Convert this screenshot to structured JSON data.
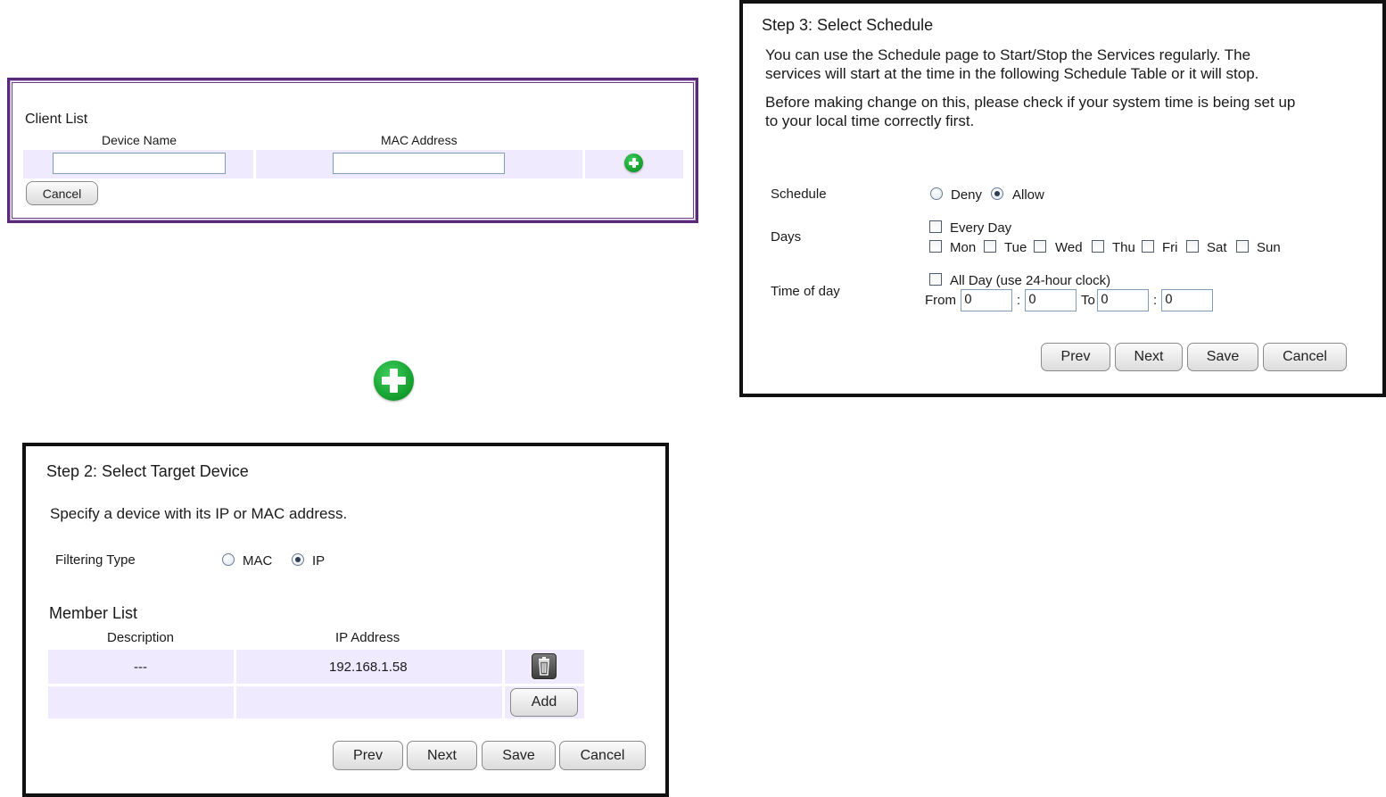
{
  "client_list": {
    "title": "Client List",
    "col_device_name": "Device Name",
    "col_mac_address": "MAC Address",
    "device_name_value": "",
    "mac_address_value": "",
    "add_icon": "plus-circle-icon",
    "cancel_label": "Cancel"
  },
  "floating_icon": "plus-circle-icon",
  "step3": {
    "title": "Step 3: Select Schedule",
    "para1_line1": "You can use the Schedule page to Start/Stop the Services regularly. The",
    "para1_line2": "services will start at the time in the following Schedule Table or it will stop.",
    "para2_line1": "Before making change on this, please check if your system time is being set up",
    "para2_line2": "to your local time correctly first.",
    "schedule_label": "Schedule",
    "deny_label": "Deny",
    "allow_label": "Allow",
    "schedule_selected": "Allow",
    "days_label": "Days",
    "every_day_label": "Every Day",
    "day_labels": [
      "Mon",
      "Tue",
      "Wed",
      "Thu",
      "Fri",
      "Sat",
      "Sun"
    ],
    "time_label": "Time of day",
    "all_day_label": "All Day (use 24-hour clock)",
    "from_label": "From",
    "to_label": "To",
    "colon": ":",
    "from_hour": "0",
    "from_min": "0",
    "to_hour": "0",
    "to_min": "0",
    "prev_label": "Prev",
    "next_label": "Next",
    "save_label": "Save",
    "cancel_label": "Cancel"
  },
  "step2": {
    "title": "Step 2: Select Target Device",
    "instruction": "Specify a device with its IP or MAC address.",
    "filtering_type_label": "Filtering Type",
    "mac_label": "MAC",
    "ip_label": "IP",
    "filtering_selected": "IP",
    "member_list_title": "Member List",
    "col_description": "Description",
    "col_ip_address": "IP Address",
    "rows": [
      {
        "description": "---",
        "ip_address": "192.168.1.58"
      }
    ],
    "delete_icon": "trash-icon",
    "add_label": "Add",
    "prev_label": "Prev",
    "next_label": "Next",
    "save_label": "Save",
    "cancel_label": "Cancel"
  },
  "colors": {
    "client_list_border": "#5a2a78",
    "row_fill": "#efeafd",
    "plus_green": "#129c2c"
  }
}
